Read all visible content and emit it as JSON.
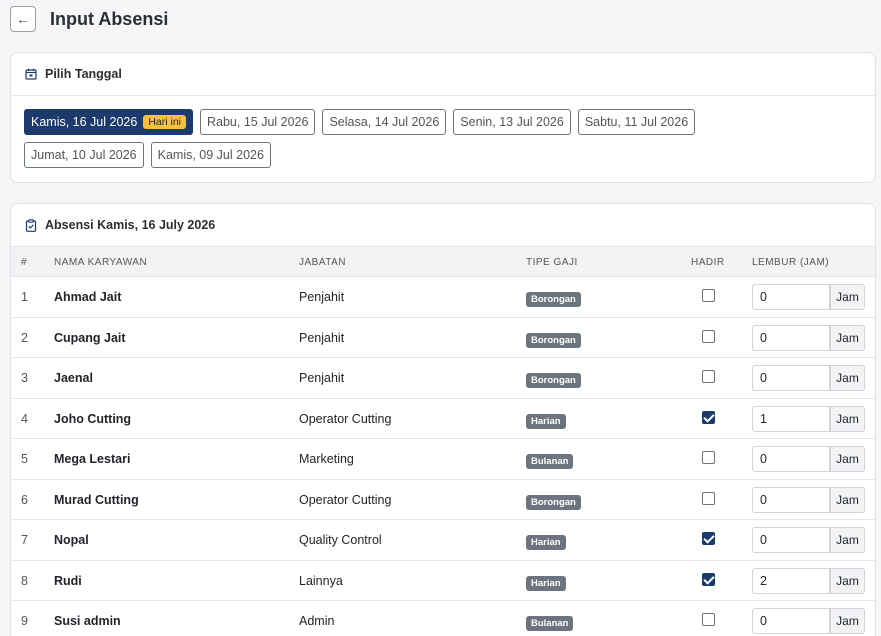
{
  "header": {
    "back_icon": "arrow-left-icon",
    "title": "Input Absensi"
  },
  "date_picker": {
    "title": "Pilih Tanggal",
    "icon": "calendar-icon",
    "dates": [
      {
        "label": "Kamis, 16 Jul 2026",
        "badge": "Hari ini",
        "active": true
      },
      {
        "label": "Rabu, 15 Jul 2026"
      },
      {
        "label": "Selasa, 14 Jul 2026"
      },
      {
        "label": "Senin, 13 Jul 2026"
      },
      {
        "label": "Sabtu, 11 Jul 2026"
      },
      {
        "label": "Jumat, 10 Jul 2026"
      },
      {
        "label": "Kamis, 09 Jul 2026"
      }
    ]
  },
  "attendance": {
    "title": "Absensi Kamis, 16 July 2026",
    "icon": "clipboard-icon",
    "columns": {
      "no": "#",
      "name": "NAMA KARYAWAN",
      "job": "JABATAN",
      "pay_type": "TIPE GAJI",
      "present": "HADIR",
      "overtime": "LEMBUR (JAM)"
    },
    "overtime_unit": "Jam",
    "rows": [
      {
        "no": "1",
        "name": "Ahmad Jait",
        "job": "Penjahit",
        "pay_type": "Borongan",
        "present": false,
        "overtime": "0"
      },
      {
        "no": "2",
        "name": "Cupang Jait",
        "job": "Penjahit",
        "pay_type": "Borongan",
        "present": false,
        "overtime": "0"
      },
      {
        "no": "3",
        "name": "Jaenal",
        "job": "Penjahit",
        "pay_type": "Borongan",
        "present": false,
        "overtime": "0"
      },
      {
        "no": "4",
        "name": "Joho Cutting",
        "job": "Operator Cutting",
        "pay_type": "Harian",
        "present": true,
        "overtime": "1"
      },
      {
        "no": "5",
        "name": "Mega Lestari",
        "job": "Marketing",
        "pay_type": "Bulanan",
        "present": false,
        "overtime": "0"
      },
      {
        "no": "6",
        "name": "Murad Cutting",
        "job": "Operator Cutting",
        "pay_type": "Borongan",
        "present": false,
        "overtime": "0"
      },
      {
        "no": "7",
        "name": "Nopal",
        "job": "Quality Control",
        "pay_type": "Harian",
        "present": true,
        "overtime": "0"
      },
      {
        "no": "8",
        "name": "Rudi",
        "job": "Lainnya",
        "pay_type": "Harian",
        "present": true,
        "overtime": "2"
      },
      {
        "no": "9",
        "name": "Susi admin",
        "job": "Admin",
        "pay_type": "Bulanan",
        "present": false,
        "overtime": "0"
      }
    ]
  },
  "colors": {
    "primary": "#1c3a6b",
    "today_badge": "#f6c23e",
    "pay_badge": "#6c757d"
  }
}
